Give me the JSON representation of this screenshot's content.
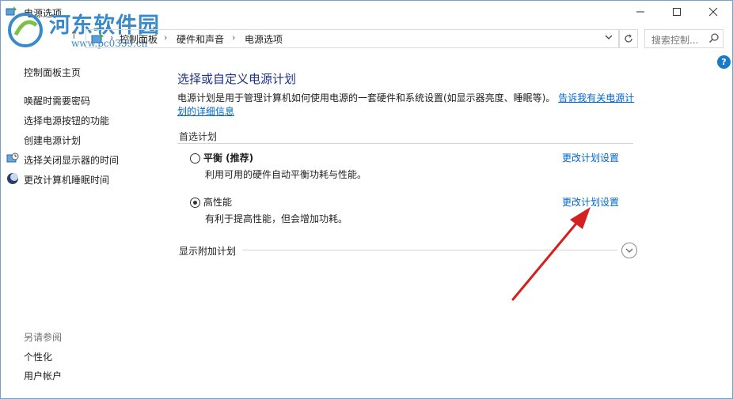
{
  "window": {
    "title": "电源选项",
    "minimize": "—",
    "maximize": "☐",
    "close": "✕"
  },
  "watermark": {
    "title": "河东软件园",
    "url": "www.pc0359.cn"
  },
  "address_bar": {
    "breadcrumbs": [
      "控制面板",
      "硬件和声音",
      "电源选项"
    ],
    "separator": "›",
    "search_placeholder": "搜索控制..."
  },
  "sidebar": {
    "home": "控制面板主页",
    "items": [
      {
        "label": "唤醒时需要密码"
      },
      {
        "label": "选择电源按钮的功能"
      },
      {
        "label": "创建电源计划"
      },
      {
        "label": "选择关闭显示器的时间",
        "icon": "clock-monitor-icon"
      },
      {
        "label": "更改计算机睡眠时间",
        "icon": "moon-icon"
      }
    ],
    "see_also_title": "另请参阅",
    "see_also": [
      {
        "label": "个性化"
      },
      {
        "label": "用户帐户"
      }
    ]
  },
  "main": {
    "heading": "选择或自定义电源计划",
    "description": "电源计划是用于管理计算机如何使用电源的一套硬件和系统设置(如显示器亮度、睡眠等)。",
    "description_link": "告诉我有关电源计划的详细信息",
    "preferred_title": "首选计划",
    "plans": [
      {
        "name": "平衡 (推荐)",
        "desc": "利用可用的硬件自动平衡功耗与性能。",
        "change": "更改计划设置",
        "selected": false
      },
      {
        "name": "高性能",
        "desc": "有利于提高性能，但会增加功耗。",
        "change": "更改计划设置",
        "selected": true
      }
    ],
    "show_more": "显示附加计划"
  },
  "colors": {
    "accent_link": "#0066cc",
    "heading": "#1e3287",
    "annotation_arrow": "#d42020"
  }
}
